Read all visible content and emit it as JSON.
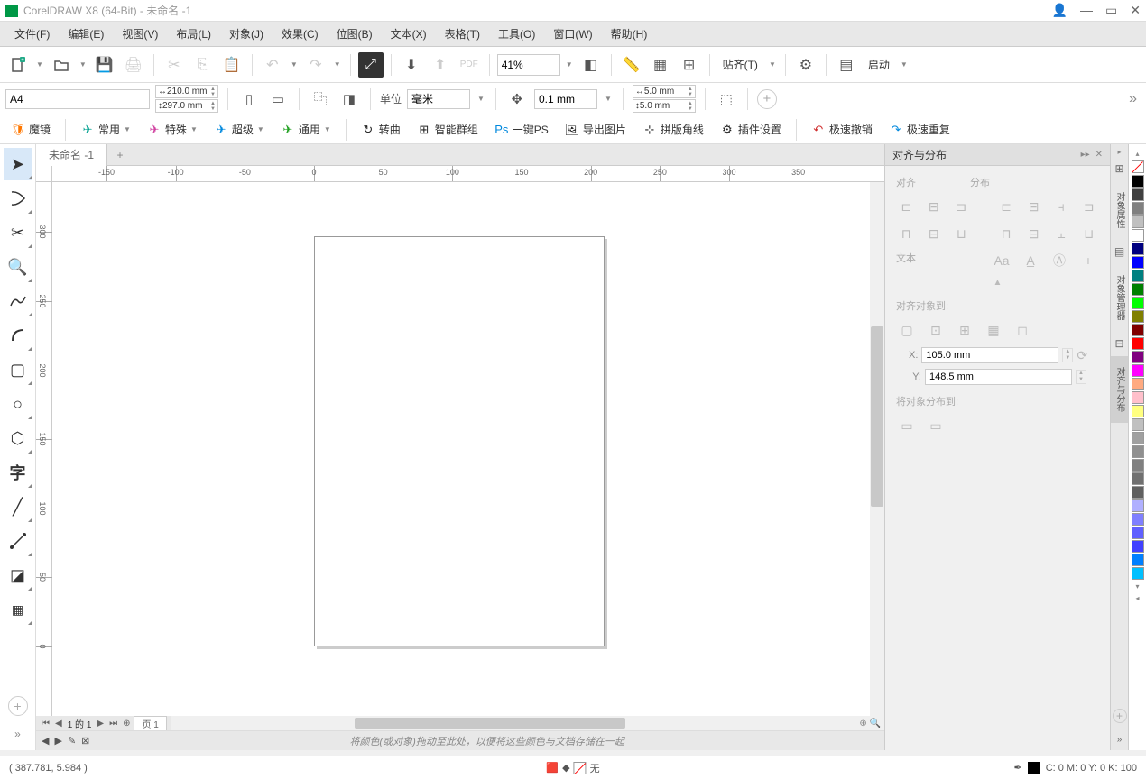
{
  "title": "CorelDRAW X8 (64-Bit) - 未命名 -1",
  "menu": [
    "文件(F)",
    "编辑(E)",
    "视图(V)",
    "布局(L)",
    "对象(J)",
    "效果(C)",
    "位图(B)",
    "文本(X)",
    "表格(T)",
    "工具(O)",
    "窗口(W)",
    "帮助(H)"
  ],
  "toolbar1": {
    "zoom": "41%",
    "snap_label": "贴齐(T)",
    "launch_label": "启动"
  },
  "propbar": {
    "page_size": "A4",
    "width": "210.0 mm",
    "height": "297.0 mm",
    "unit_label": "单位",
    "unit": "毫米",
    "nudge": "0.1 mm",
    "dup_x": "5.0 mm",
    "dup_y": "5.0 mm"
  },
  "pluginbar": [
    {
      "icon": "shield",
      "label": "魔镜",
      "color": "orange",
      "drop": false
    },
    {
      "icon": "send",
      "label": "常用",
      "color": "teal",
      "drop": true
    },
    {
      "icon": "send",
      "label": "特殊",
      "color": "pink",
      "drop": true
    },
    {
      "icon": "send",
      "label": "超级",
      "color": "blue",
      "drop": true
    },
    {
      "icon": "send",
      "label": "通用",
      "color": "green",
      "drop": true
    },
    {
      "icon": "refresh",
      "label": "转曲",
      "color": "black",
      "drop": false
    },
    {
      "icon": "grid",
      "label": "智能群组",
      "color": "black",
      "drop": false
    },
    {
      "icon": "ps",
      "label": "一键PS",
      "color": "blue",
      "drop": false
    },
    {
      "icon": "image",
      "label": "导出图片",
      "color": "black",
      "drop": false
    },
    {
      "icon": "corner",
      "label": "拼版角线",
      "color": "black",
      "drop": false
    },
    {
      "icon": "gear",
      "label": "插件设置",
      "color": "black",
      "drop": false
    },
    {
      "icon": "undo",
      "label": "极速撤销",
      "color": "red",
      "drop": false
    },
    {
      "icon": "redo",
      "label": "极速重复",
      "color": "blue",
      "drop": false
    }
  ],
  "doc_tab": "未命名 -1",
  "ruler_h": [
    -150,
    -100,
    -50,
    0,
    50,
    100,
    150,
    200,
    250,
    300,
    350
  ],
  "ruler_v": [
    300,
    250,
    200,
    150,
    100,
    50,
    0
  ],
  "page_nav": {
    "info": "1 的 1",
    "page_tab": "页 1"
  },
  "hint_text": "将颜色(或对象)拖动至此处，以便将这些颜色与文档存储在一起",
  "docker": {
    "title": "对齐与分布",
    "align_h": "对齐",
    "dist_h": "分布",
    "text_h": "文本",
    "align_to": "对齐对象到:",
    "dist_to": "将对象分布到:",
    "x_label": "X:",
    "y_label": "Y:",
    "x_val": "105.0 mm",
    "y_val": "148.5 mm"
  },
  "docker_tabs": [
    "对象属性",
    "对象管理器",
    "对齐与分布"
  ],
  "colors": [
    "#000000",
    "#404040",
    "#808080",
    "#c0c0c0",
    "#ffffff",
    "#000080",
    "#0000ff",
    "#008080",
    "#008000",
    "#00ff00",
    "#808000",
    "#800000",
    "#ff0000",
    "#800080",
    "#ff00ff",
    "#ffaa80",
    "#ffc0cb",
    "#ffff80",
    "#c0c0c0",
    "#a0a0a0",
    "#909090",
    "#808080",
    "#707070",
    "#606060",
    "#b0b0ff",
    "#8080ff",
    "#6060ff",
    "#4040ff",
    "#0080ff",
    "#00c0ff"
  ],
  "status": {
    "coords": "( 387.781, 5.984 )",
    "fill_label": "无",
    "outline": "C: 0 M: 0 Y: 0 K: 100"
  }
}
